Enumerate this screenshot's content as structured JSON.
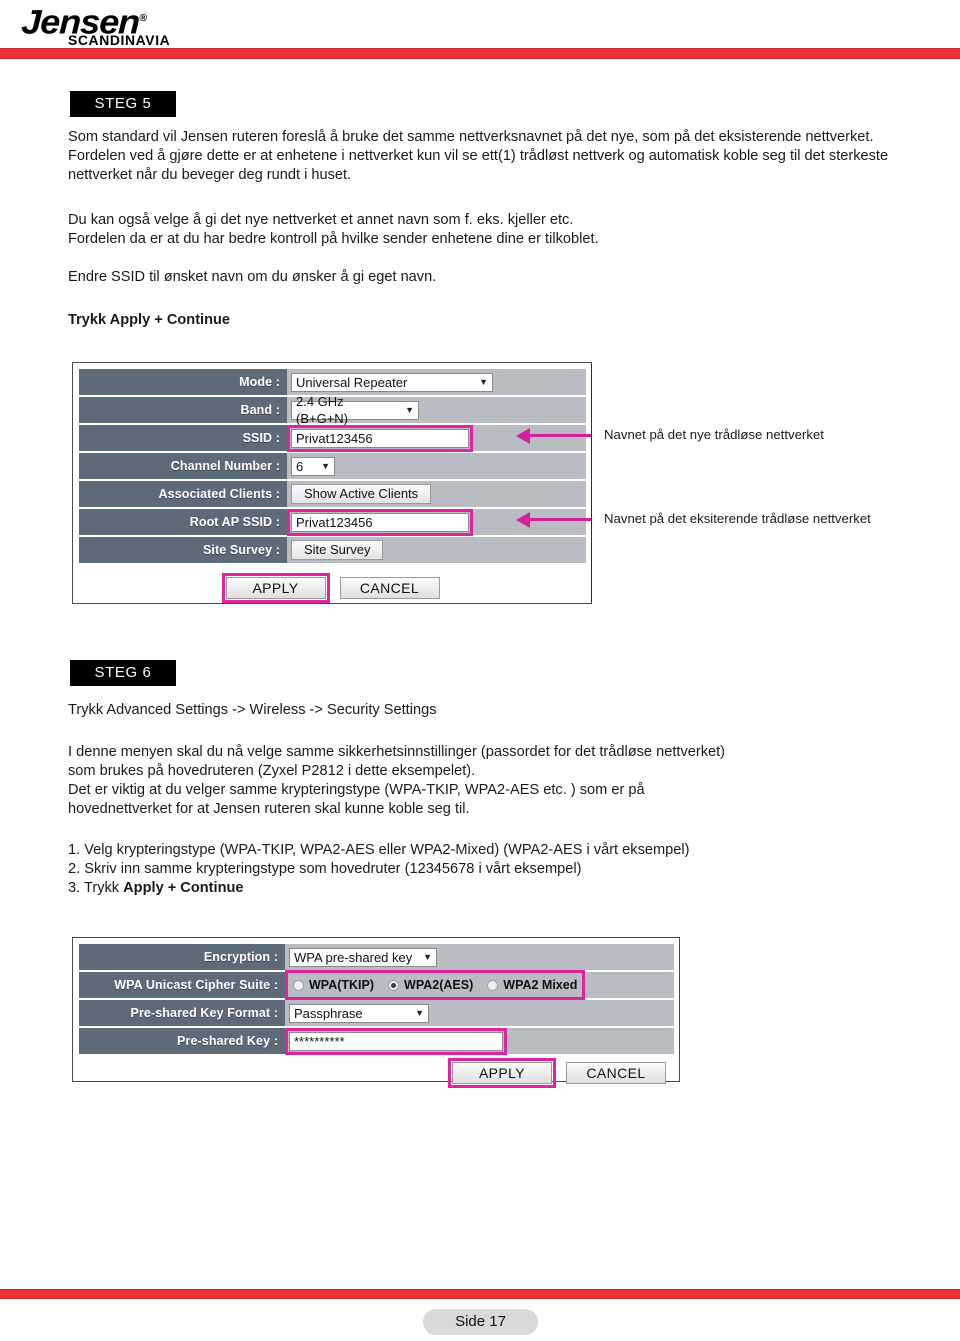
{
  "header": {
    "brand": "Jensen",
    "brand_reg": "®",
    "brand_sub": "SCANDINAVIA",
    "rule_color": "#ed3237"
  },
  "steps": {
    "step5": {
      "badge": "STEG 5",
      "para1": "Som standard vil Jensen ruteren foreslå å bruke det samme nettverksnavnet på det nye, som på det eksisterende nettverket. Fordelen ved å gjøre dette er at enhetene i nettverket kun vil se ett(1) trådløst nettverk og automatisk koble seg til det sterkeste nettverket når du beveger deg rundt i huset.",
      "para2_line1": "Du kan også velge å gi det nye nettverket et annet navn som f. eks. kjeller etc.",
      "para2_line2": "Fordelen da er at du har bedre kontroll på hvilke sender enhetene dine er tilkoblet.",
      "para3": "Endre SSID til ønsket navn om du ønsker å gi eget navn.",
      "para4_bold": "Trykk Apply + Continue"
    },
    "step6": {
      "badge": "STEG 6",
      "para1": "Trykk Advanced Settings -> Wireless -> Security Settings",
      "para2_line1": "I denne menyen skal du nå velge samme sikkerhetsinnstillinger (passordet for det trådløse nettverket)",
      "para2_line2": "som brukes på hovedruteren (Zyxel P2812 i dette eksempelet).",
      "para2_line3": "Det er viktig at du velger samme krypteringstype (WPA-TKIP, WPA2-AES etc. ) som er på",
      "para2_line4": "hovednettverket for at Jensen ruteren skal kunne koble seg til.",
      "list": {
        "item1": "1. Velg krypteringstype (WPA-TKIP, WPA2-AES eller WPA2-Mixed)   (WPA2-AES i vårt eksempel)",
        "item2": "2. Skriv inn samme krypteringstype som hovedruter (12345678 i vårt eksempel)",
        "item3_prefix": "3. Trykk ",
        "item3_bold": "Apply + Continue"
      }
    }
  },
  "router_panel_1": {
    "rows": [
      {
        "label": "Mode :",
        "control": "select",
        "value": "Universal Repeater",
        "caret": "▼",
        "highlight": false
      },
      {
        "label": "Band :",
        "control": "select",
        "value": "2.4 GHz (B+G+N)",
        "caret": "▼",
        "highlight": false
      },
      {
        "label": "SSID :",
        "control": "text",
        "value": "Privat123456",
        "highlight": true
      },
      {
        "label": "Channel Number :",
        "control": "select",
        "value": "6",
        "caret": "▼",
        "highlight": false
      },
      {
        "label": "Associated Clients :",
        "control": "button",
        "value": "Show Active Clients",
        "highlight": false
      },
      {
        "label": "Root AP SSID :",
        "control": "text",
        "value": "Privat123456",
        "highlight": true
      },
      {
        "label": "Site Survey :",
        "control": "button",
        "value": "Site Survey",
        "highlight": false
      }
    ],
    "apply_label": "APPLY",
    "cancel_label": "CANCEL",
    "highlight_color": "#e0239f"
  },
  "callouts": [
    {
      "text": "Navnet på det nye trådløse nettverket",
      "arrow_color": "#d4219b"
    },
    {
      "text": "Navnet på det eksiterende trådløse nettverket",
      "arrow_color": "#d4219b"
    }
  ],
  "router_panel_2": {
    "rows": [
      {
        "label": "Encryption :",
        "control": "select",
        "value": "WPA pre-shared key",
        "caret": "▼",
        "highlight": false
      },
      {
        "label": "WPA Unicast Cipher Suite :",
        "control": "radios",
        "highlight": true,
        "options": [
          {
            "label": "WPA(TKIP)",
            "selected": false
          },
          {
            "label": "WPA2(AES)",
            "selected": true
          },
          {
            "label": "WPA2 Mixed",
            "selected": false
          }
        ]
      },
      {
        "label": "Pre-shared Key Format :",
        "control": "select",
        "value": "Passphrase",
        "caret": "▼",
        "highlight": false
      },
      {
        "label": "Pre-shared Key :",
        "control": "text",
        "value": "**********",
        "highlight": true
      }
    ],
    "apply_label": "APPLY",
    "cancel_label": "CANCEL"
  },
  "footer": {
    "page_label": "Side 17"
  }
}
